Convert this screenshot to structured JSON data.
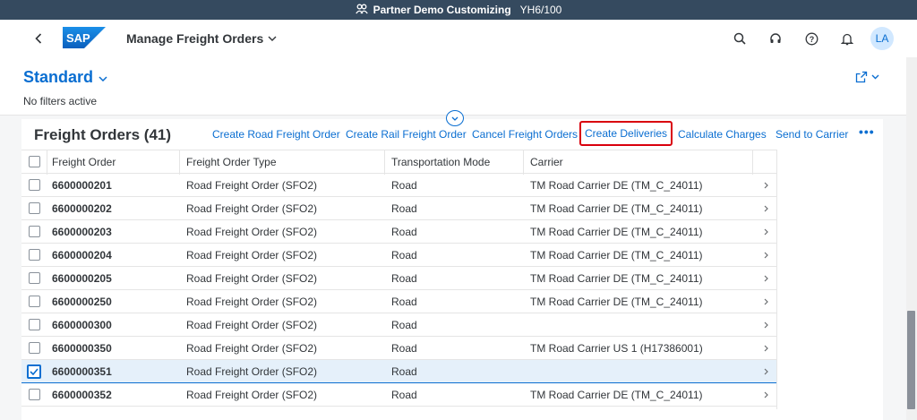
{
  "system_bar": {
    "title": "Partner Demo Customizing",
    "client": "YH6/100",
    "icon": "people-icon"
  },
  "shell": {
    "back_icon": "back-icon",
    "logo": "SAP",
    "app_title": "Manage Freight Orders",
    "icons": [
      "search-icon",
      "headset-icon",
      "help-icon",
      "bell-icon"
    ],
    "avatar_initials": "LA"
  },
  "header": {
    "variant": "Standard",
    "filters_text": "No filters active"
  },
  "toolbar": {
    "title": "Freight Orders (41)",
    "buttons": [
      "Create Road Freight Order",
      "Create Rail Freight Order",
      "Cancel Freight Orders",
      "Create Deliveries",
      "Calculate Charges",
      "Send to Carrier"
    ],
    "more": "•••",
    "highlight_color": "#d9000d"
  },
  "table": {
    "columns": [
      "Freight Order",
      "Freight Order Type",
      "Transportation Mode",
      "Carrier"
    ],
    "rows": [
      {
        "order": "6600000201",
        "type": "Road Freight Order (SFO2)",
        "mode": "Road",
        "carrier": "TM Road Carrier DE (TM_C_24011)",
        "checked": false
      },
      {
        "order": "6600000202",
        "type": "Road Freight Order (SFO2)",
        "mode": "Road",
        "carrier": "TM Road Carrier DE (TM_C_24011)",
        "checked": false
      },
      {
        "order": "6600000203",
        "type": "Road Freight Order (SFO2)",
        "mode": "Road",
        "carrier": "TM Road Carrier DE (TM_C_24011)",
        "checked": false
      },
      {
        "order": "6600000204",
        "type": "Road Freight Order (SFO2)",
        "mode": "Road",
        "carrier": "TM Road Carrier DE (TM_C_24011)",
        "checked": false
      },
      {
        "order": "6600000205",
        "type": "Road Freight Order (SFO2)",
        "mode": "Road",
        "carrier": "TM Road Carrier DE (TM_C_24011)",
        "checked": false
      },
      {
        "order": "6600000250",
        "type": "Road Freight Order (SFO2)",
        "mode": "Road",
        "carrier": "TM Road Carrier DE (TM_C_24011)",
        "checked": false
      },
      {
        "order": "6600000300",
        "type": "Road Freight Order (SFO2)",
        "mode": "Road",
        "carrier": "",
        "checked": false
      },
      {
        "order": "6600000350",
        "type": "Road Freight Order (SFO2)",
        "mode": "Road",
        "carrier": "TM Road Carrier US 1 (H17386001)",
        "checked": false
      },
      {
        "order": "6600000351",
        "type": "Road Freight Order (SFO2)",
        "mode": "Road",
        "carrier": "",
        "checked": true
      },
      {
        "order": "6600000352",
        "type": "Road Freight Order (SFO2)",
        "mode": "Road",
        "carrier": "TM Road Carrier DE (TM_C_24011)",
        "checked": false
      }
    ]
  },
  "colors": {
    "shell_bar": "#354a5f",
    "accent": "#0a6ed1",
    "selected_row": "#e5f0fa"
  }
}
